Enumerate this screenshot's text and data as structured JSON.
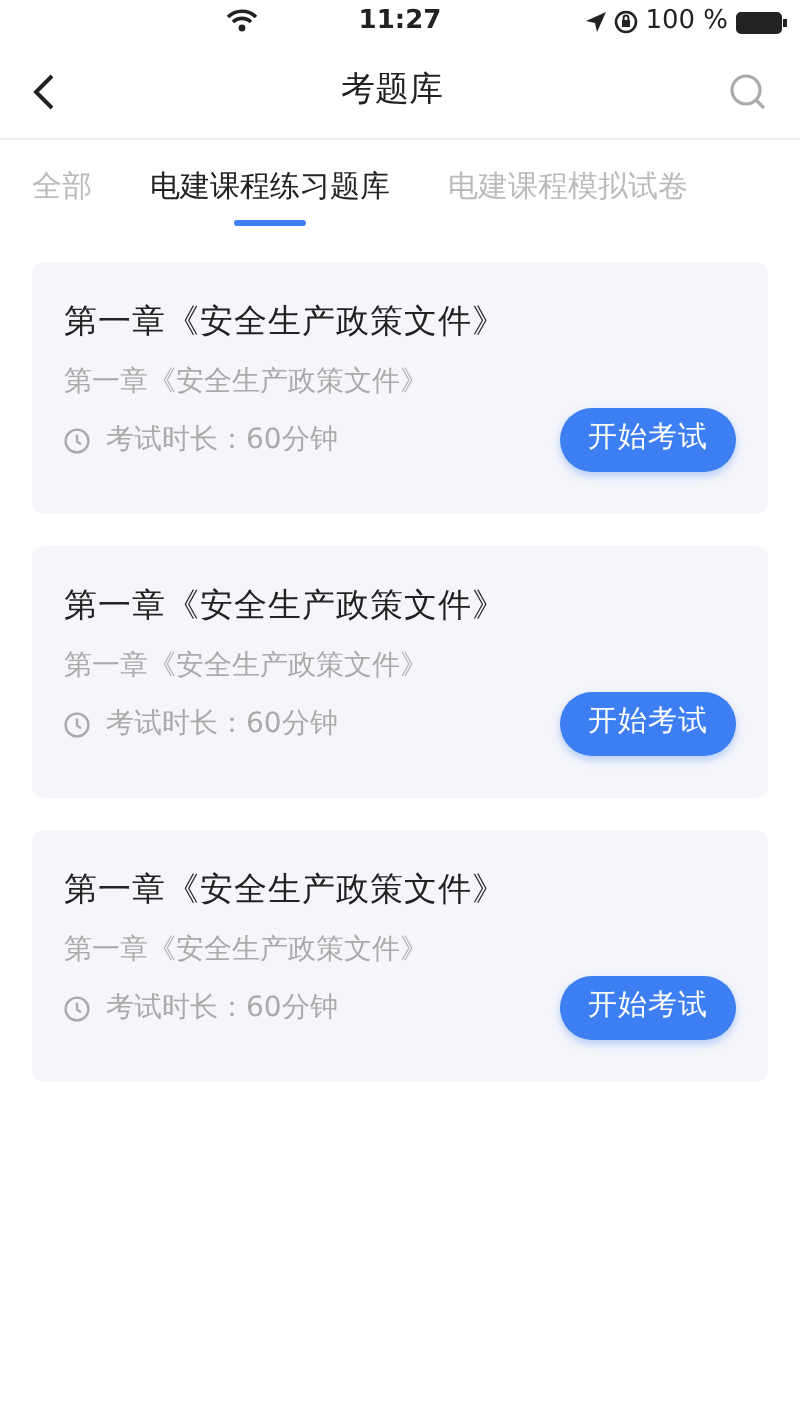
{
  "status_bar": {
    "time": "11:27",
    "battery": "100 %"
  },
  "nav": {
    "title": "考题库"
  },
  "tabs": [
    {
      "label": "全部",
      "selected": false
    },
    {
      "label": "电建课程练习题库",
      "selected": true
    },
    {
      "label": "电建课程模拟试卷",
      "selected": false
    }
  ],
  "exams": [
    {
      "title": "第一章《安全生产政策文件》",
      "subtitle": "第一章《安全生产政策文件》",
      "duration": "考试时长：60分钟",
      "button": "开始考试"
    },
    {
      "title": "第一章《安全生产政策文件》",
      "subtitle": "第一章《安全生产政策文件》",
      "duration": "考试时长：60分钟",
      "button": "开始考试"
    },
    {
      "title": "第一章《安全生产政策文件》",
      "subtitle": "第一章《安全生产政策文件》",
      "duration": "考试时长：60分钟",
      "button": "开始考试"
    }
  ]
}
